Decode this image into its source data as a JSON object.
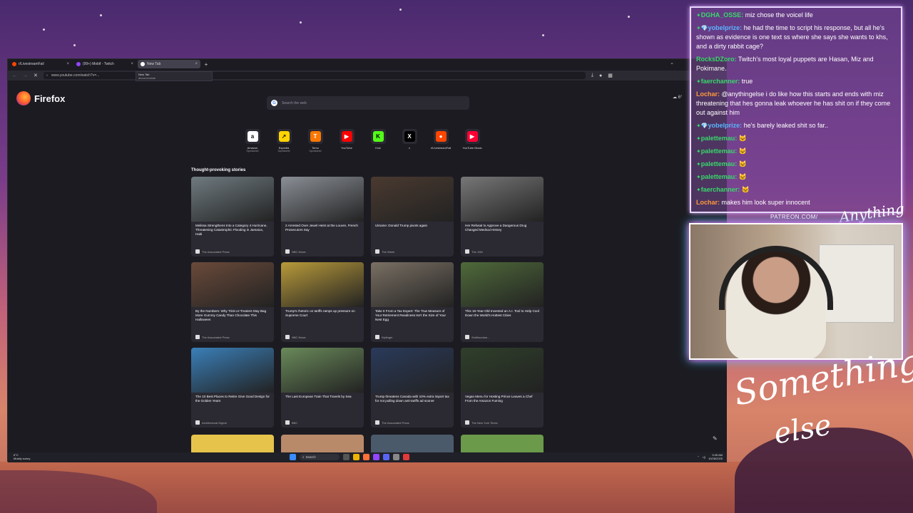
{
  "browser": {
    "tabs": [
      {
        "label": "r/LivestreamFail",
        "color": "#ff4500"
      },
      {
        "label": "(99+) Mobif - Twitch",
        "color": "#9146ff"
      },
      {
        "label": "New Tab",
        "color": "#ffffff"
      }
    ],
    "url": "www.youtube.com/watch?v=...",
    "suggestion": {
      "title": "New Tab",
      "sub": "about:newtab"
    }
  },
  "newtab": {
    "brand": "Firefox",
    "search_placeholder": "Search the web",
    "weather": "6°",
    "shortcuts": [
      {
        "label": "Amazon",
        "sponsored": "Sponsored",
        "glyph": "a",
        "bg": "#ffffff",
        "fg": "#111111"
      },
      {
        "label": "Expedia",
        "sponsored": "Sponsored",
        "glyph": "↗",
        "bg": "#ffd400",
        "fg": "#1a1a1a"
      },
      {
        "label": "Temu",
        "sponsored": "Sponsored",
        "glyph": "T",
        "bg": "#fb7701",
        "fg": "#ffffff"
      },
      {
        "label": "YouTube",
        "sponsored": "",
        "glyph": "▶",
        "bg": "#ff0000",
        "fg": "#ffffff"
      },
      {
        "label": "Kick",
        "sponsored": "",
        "glyph": "K",
        "bg": "#53fc18",
        "fg": "#000000"
      },
      {
        "label": "x",
        "sponsored": "",
        "glyph": "X",
        "bg": "#000000",
        "fg": "#ffffff"
      },
      {
        "label": "r/LivestreamFail",
        "sponsored": "",
        "glyph": "●",
        "bg": "#ff4500",
        "fg": "#ffffff"
      },
      {
        "label": "YouTube Music",
        "sponsored": "",
        "glyph": "▶",
        "bg": "#ff0033",
        "fg": "#ffffff"
      }
    ],
    "stories_title": "Thought-provoking stories",
    "stories": [
      {
        "title": "Melissa Strengthens Into a Category 4 Hurricane, Threatening Catastrophic Flooding in Jamaica, Haiti",
        "source": "The Associated Press",
        "img": "#6f7b80"
      },
      {
        "title": "2 Arrested Over Jewel Heist at the Louvre, French Prosecutors Say",
        "source": "NBC News",
        "img": "#8a8f96"
      },
      {
        "title": "Ukraine: Donald Trump pivots again",
        "source": "The Week",
        "img": "#4a3a30"
      },
      {
        "title": "Her Refusal to Approve a Dangerous Drug Changed Medical History",
        "source": "The 19th",
        "img": "#777777"
      },
      {
        "title": "By the Numbers: Why Trick-or-Treaters May Bag More Gummy Candy Than Chocolate This Halloween",
        "source": "The Associated Press",
        "img": "#6a4a3a"
      },
      {
        "title": "Trump's rhetoric on tariffs ramps up pressure on Supreme Court",
        "source": "NBC News",
        "img": "#b89a3a"
      },
      {
        "title": "Take It From a Tax Expert: The True Measure of Your Retirement Readiness Isn't the Size of Your Nest Egg",
        "source": "Kiplinger",
        "img": "#7a7064"
      },
      {
        "title": "This 16-Year-Old Invented an A.I. Tool to Help Cool Down the World's Hottest Cities",
        "source": "Smithsonian...",
        "img": "#4f6a3a"
      },
      {
        "title": "The 10 Best Places to Retire Give Good Design for the Golden Years",
        "source": "Architectural Digest",
        "img": "#3a7fb8"
      },
      {
        "title": "The Last European Train That Travels by Sea",
        "source": "BBC",
        "img": "#6a8a5a"
      },
      {
        "title": "Trump threatens Canada with 10% extra import tax for not pulling down anti-tariffs ad sooner",
        "source": "The Associated Press",
        "img": "#2a3a5a"
      },
      {
        "title": "Vegan Menu for Hosting Prince Leaves a Chef From the Amazon Fuming",
        "source": "The New York Times",
        "img": "#2f3f2a"
      }
    ],
    "partial_row": [
      "#e6c34a",
      "#b88a6a",
      "#4a5a6a",
      "#6a9a4a"
    ]
  },
  "taskbar": {
    "weather_temp": "6°C",
    "weather_desc": "Mostly sunny",
    "search": "Search",
    "time": "9:45 AM",
    "date": "10/28/2025"
  },
  "chat": [
    {
      "user": "DGHA_OSSE:",
      "color": "#37d96a",
      "badge": "✦",
      "text": "miz chose the voicel life"
    },
    {
      "user": "yobelprize:",
      "color": "#5ab4ff",
      "badge": "✦💎",
      "text": "he had the time to script his response, but all he's shown as evidence is one text ss where she says she wants to khs, and a dirty rabbit cage?"
    },
    {
      "user": "RocksDZoro:",
      "color": "#37d96a",
      "badge": "",
      "text": "Twitch's most loyal puppets are Hasan, Miz and Pokimane."
    },
    {
      "user": "faerchanner:",
      "color": "#37d96a",
      "badge": "✦",
      "text": "true"
    },
    {
      "user": "Lochar:",
      "color": "#ff9a3c",
      "badge": "",
      "text": "@anythingelse i do like how this starts and ends with miz threatening that hes gonna leak whoever he has shit on if they come out against him"
    },
    {
      "user": "yobelprize:",
      "color": "#5ab4ff",
      "badge": "✦💎",
      "text": "he's barely leaked shit so far.."
    },
    {
      "user": "palettemau:",
      "color": "#37d96a",
      "badge": "✦",
      "text": "🐱"
    },
    {
      "user": "palettemau:",
      "color": "#37d96a",
      "badge": "✦",
      "text": "🐱"
    },
    {
      "user": "palettemau:",
      "color": "#37d96a",
      "badge": "✦",
      "text": "🐱"
    },
    {
      "user": "palettemau:",
      "color": "#37d96a",
      "badge": "✦",
      "text": "🐱"
    },
    {
      "user": "faerchanner:",
      "color": "#37d96a",
      "badge": "✦",
      "text": "🐱"
    },
    {
      "user": "Lochar:",
      "color": "#ff9a3c",
      "badge": "",
      "text": "makes him look super innocent"
    }
  ],
  "overlay": {
    "patreon": "PATREON.COM/",
    "patreon_script": "Anything else",
    "signature_line1": "Something",
    "signature_line2": "else"
  }
}
